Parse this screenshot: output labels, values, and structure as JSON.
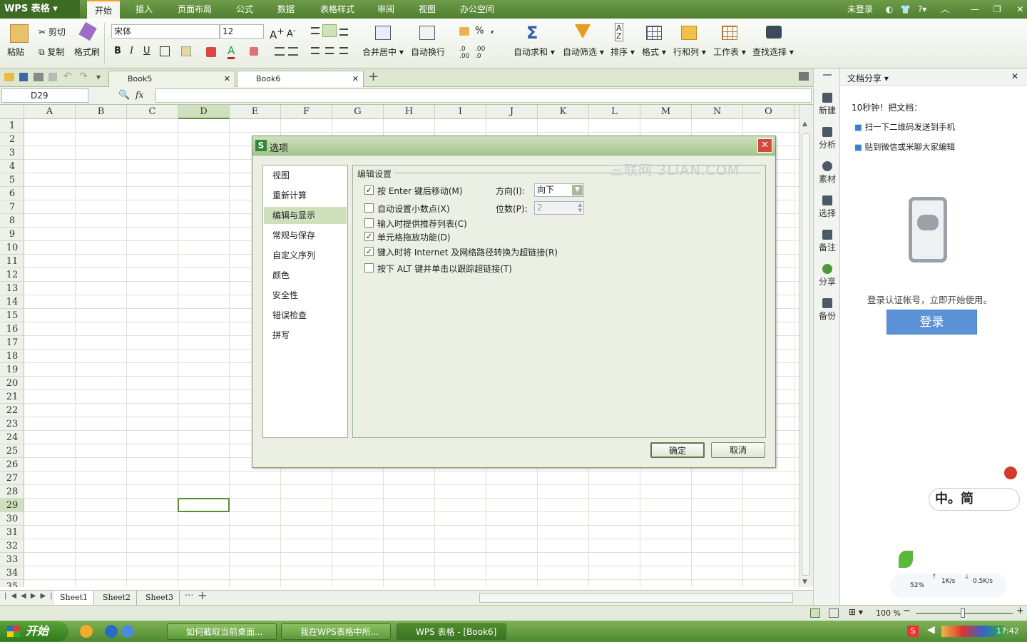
{
  "app": {
    "title": "WPS 表格",
    "menu": [
      "开始",
      "插入",
      "页面布局",
      "公式",
      "数据",
      "表格样式",
      "审阅",
      "视图",
      "办公空间"
    ],
    "login": "未登录"
  },
  "ribbon": {
    "paste": "粘贴",
    "cut": "剪切",
    "copy": "复制",
    "format_painter": "格式刷",
    "font": "宋体",
    "size": "12",
    "bold": "B",
    "italic": "I",
    "underline": "U",
    "merge": "合并居中",
    "wrap": "自动换行",
    "percent": "%",
    "autosum": "自动求和",
    "autofilter": "自动筛选",
    "sort": "排序",
    "format": "格式",
    "rowcol": "行和列",
    "worksheet": "工作表",
    "find": "查找选择"
  },
  "doctabs": [
    "Book5",
    "Book6"
  ],
  "formula": {
    "cell_ref": "D29",
    "fx": "fx"
  },
  "columns": [
    "A",
    "B",
    "C",
    "D",
    "E",
    "F",
    "G",
    "H",
    "I",
    "J",
    "K",
    "L",
    "M",
    "N",
    "O"
  ],
  "rows": [
    "1",
    "2",
    "3",
    "4",
    "5",
    "6",
    "7",
    "8",
    "9",
    "10",
    "11",
    "12",
    "13",
    "14",
    "15",
    "16",
    "17",
    "18",
    "19",
    "20",
    "21",
    "22",
    "23",
    "24",
    "25",
    "26",
    "27",
    "28",
    "29",
    "30",
    "31",
    "32",
    "33",
    "34",
    "35"
  ],
  "sheets": [
    "Sheet1",
    "Sheet2",
    "Sheet3"
  ],
  "sidetool": [
    "新建",
    "分析",
    "素材",
    "选择",
    "备注",
    "分享",
    "备份"
  ],
  "pane": {
    "title": "文档分享",
    "intro": "10秒钟！把文档：",
    "bullets": [
      "扫一下二维码发送到手机",
      "贴到微信或米聊大家编辑"
    ],
    "prompt": "登录认证帐号，立即开始使用。",
    "login_btn": "登录"
  },
  "dialog": {
    "title": "选项",
    "nav": [
      "视图",
      "重新计算",
      "编辑与显示",
      "常规与保存",
      "自定义序列",
      "颜色",
      "安全性",
      "错误检查",
      "拼写"
    ],
    "group": "编辑设置",
    "watermark": "三联网 3LIAN.COM",
    "options": [
      {
        "label": "按 Enter 键后移动(M)",
        "checked": true
      },
      {
        "label": "自动设置小数点(X)",
        "checked": false
      },
      {
        "label": "输入时提供推荐列表(C)",
        "checked": false
      },
      {
        "label": "单元格拖放功能(D)",
        "checked": true
      },
      {
        "label": "键入时将 Internet 及网络路径转换为超链接(R)",
        "checked": true
      },
      {
        "label": "按下 ALT 键并单击以跟踪超链接(T)",
        "checked": false
      }
    ],
    "direction_label": "方向(I):",
    "direction_value": "向下",
    "digits_label": "位数(P):",
    "digits_value": "2",
    "ok": "确定",
    "cancel": "取消"
  },
  "status": {
    "zoom": "100 %"
  },
  "ime": {
    "text": "中。简"
  },
  "net": {
    "percent": "52%",
    "up": "1K/s",
    "down": "0.5K/s"
  },
  "taskbar": {
    "start": "开始",
    "items": [
      "如何截取当前桌面...",
      "我在WPS表格中所...",
      "WPS 表格 - [Book6]"
    ],
    "time": "17:42"
  }
}
